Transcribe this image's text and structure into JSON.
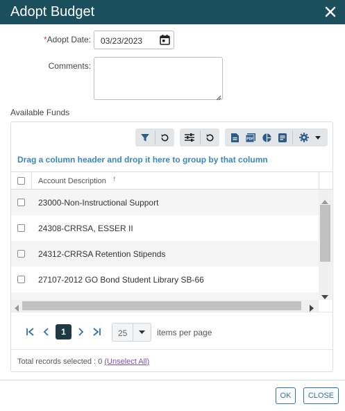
{
  "dialog": {
    "title": "Adopt Budget",
    "close_icon": "close-icon"
  },
  "form": {
    "adopt_date_required_mark": "*",
    "adopt_date_label": "Adopt Date:",
    "adopt_date_value": "03/23/2023",
    "comments_label": "Comments:",
    "comments_value": ""
  },
  "funds": {
    "section_label": "Available Funds",
    "toolbar_icons": [
      "filter-icon",
      "reset-icon",
      "columns-settings-icon",
      "refresh-icon",
      "export-file-icon",
      "export-pdf-icon",
      "chart-icon",
      "list-icon",
      "settings-icon",
      "dropdown-caret-icon"
    ],
    "group_hint": "Drag a column header and drop it here to group by that column",
    "column_header": "Account Description",
    "sort_indicator": "↑",
    "rows": [
      {
        "description": "23000-Non-Instructional Support"
      },
      {
        "description": "24308-CRRSA, ESSER II"
      },
      {
        "description": "24312-CRRSA Retention Stipends"
      },
      {
        "description": "27107-2012 GO Bond Student Library SB-66"
      }
    ],
    "pager": {
      "current_page": "1",
      "page_size": "25",
      "items_per_page_label": "items per page"
    },
    "total_selected_label": "Total records selected : 0",
    "unselect_all_label": "(Unselect All)"
  },
  "actions": {
    "ok_label": "OK",
    "close_label": "CLOSE"
  },
  "colors": {
    "titlebar": "#1c4f5e",
    "accent": "#2b72a6",
    "current_page": "#1f3a45",
    "toolbar_icon": "#2b5b8c"
  }
}
